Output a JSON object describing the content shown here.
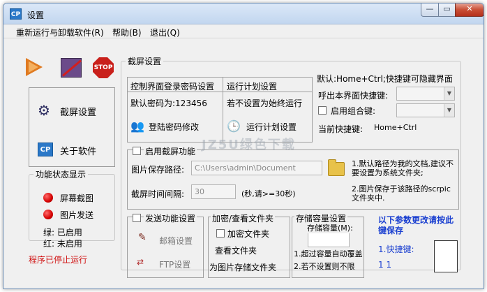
{
  "window": {
    "title": "设置",
    "app_icon": "CP",
    "close_glyph": "✕",
    "min_glyph": "—",
    "max_glyph": "▭"
  },
  "menu": [
    "重新运行与卸载软件(R)",
    "帮助(B)",
    "退出(Q)"
  ],
  "toolbar": {
    "stop_label": "STOP"
  },
  "nav": {
    "screenshot_settings": "截屏设置",
    "about_software": "关于软件",
    "about_icon": "CP"
  },
  "status_legend": {
    "title": "功能状态显示",
    "items": [
      "屏幕截图",
      "图片发送"
    ],
    "green_note": "绿: 已启用",
    "red_note": "红: 未启用",
    "stopped_text": "程序已停止运行",
    "led_color": "#d40000"
  },
  "main": {
    "group_title": "截屏设置",
    "password_header": "控制界面登录密码设置",
    "default_password": "默认密码为:123456",
    "change_password": "登陆密码修改",
    "schedule_header": "运行计划设置",
    "schedule_note": "若不设置为始终运行",
    "schedule_button": "运行计划设置",
    "hotkey_title": "默认:Home+Ctrl;快捷键可隐藏界面",
    "hotkey_label": "呼出本界面快捷键:",
    "combo_label": "启用组合键:",
    "current_hotkey_label": "当前快捷键:",
    "current_hotkey_value": "Home+Ctrl",
    "enable_capture": "启用截屏功能",
    "save_path_label": "图片保存路径:",
    "save_path_value": "C:\\Users\\admin\\Document",
    "interval_label": "截屏时间间隔:",
    "interval_value": "30",
    "interval_unit": "(秒,请>=30秒)",
    "path_note_1": "1.默认路径为我的文档,建议不要设置为系统文件夹;",
    "path_note_2": "2.图片保存于该路径的scrpic文件夹中."
  },
  "send": {
    "title": "发送功能设置",
    "mail_settings": "邮箱设置",
    "ftp_settings": "FTP设置"
  },
  "encrypt": {
    "title": "加密/查看文件夹",
    "encrypt_folder": "加密文件夹",
    "view_folder": "查看文件夹",
    "storage_folder": "为图片存储文件夹"
  },
  "storage": {
    "title": "存储容量设置",
    "capacity_label": "存储容量(M):",
    "note_1": "1.超过容量自动覆盖",
    "note_2": "2.若不设置则不限"
  },
  "hint": {
    "title": "以下参数更改请按此键保存",
    "item": "1.快捷键:",
    "item_2": "1 1",
    "accent": "#1a3fd0"
  },
  "watermark": "JZ5U绿色下载"
}
